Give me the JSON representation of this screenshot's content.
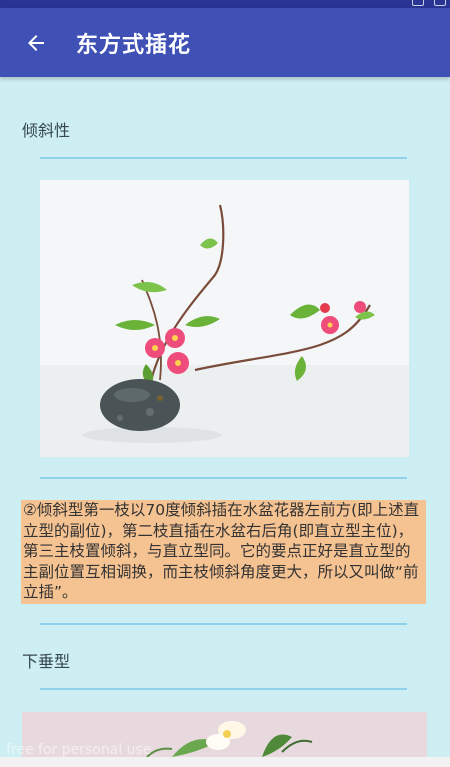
{
  "appbar": {
    "title": "东方式插花",
    "back_icon": "arrow-left-icon"
  },
  "sections": [
    {
      "label": "倾斜性",
      "image_subject": "slanting ikebana arrangement with pink blossoms in a dark stone bowl",
      "description": "②倾斜型第一枝以70度倾斜插在水盆花器左前方(即上述直立型的副位)，第二枝直插在水盆右后角(即直立型主位)，第三主枝置倾斜，与直立型同。它的要点正好是直立型的主副位置互相调换，而主枝倾斜角度更大，所以又叫做“前立插”。"
    },
    {
      "label": "下垂型",
      "image_subject": "cascading arrangement with white flowers"
    }
  ],
  "watermark": "free for personal use",
  "colors": {
    "appbar": "#3f51b5",
    "statusbar": "#283593",
    "background": "#cdeef2",
    "divider": "#8fd0ea",
    "description_highlight": "#f5c292"
  }
}
